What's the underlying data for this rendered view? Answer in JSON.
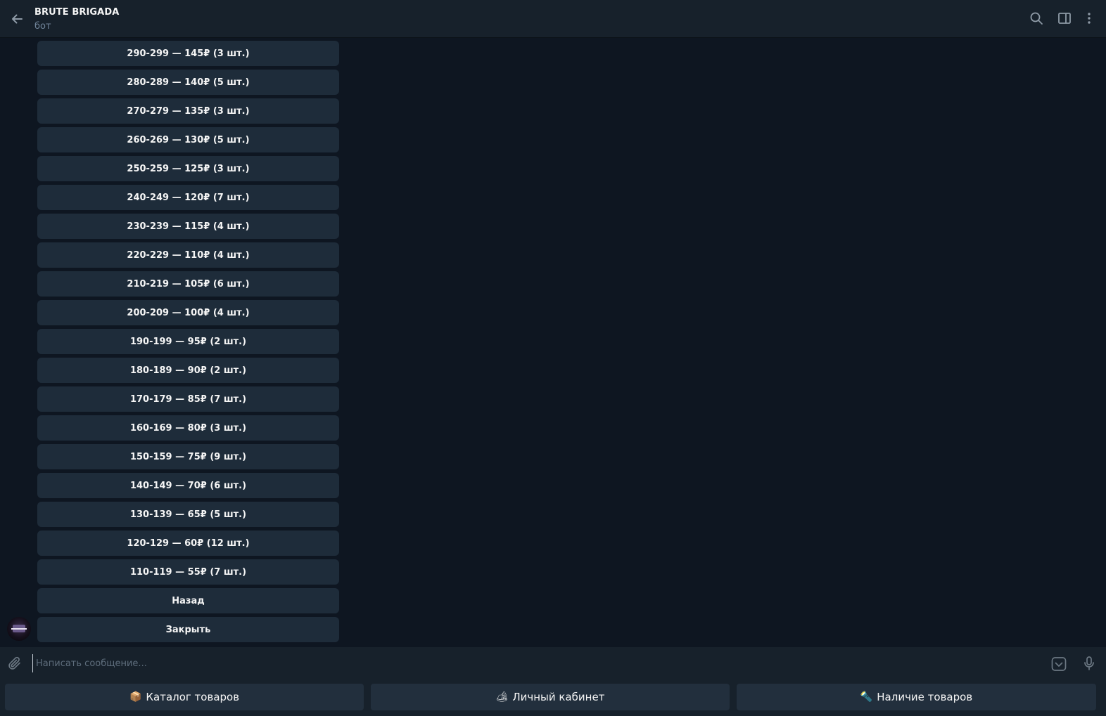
{
  "header": {
    "title": "BRUTE BRIGADA",
    "subtitle": "бот"
  },
  "inline_keyboard": [
    "290-299 — 145₽ (3 шт.)",
    "280-289 — 140₽ (5 шт.)",
    "270-279 — 135₽ (3 шт.)",
    "260-269 — 130₽ (5 шт.)",
    "250-259 — 125₽ (3 шт.)",
    "240-249 — 120₽ (7 шт.)",
    "230-239 — 115₽ (4 шт.)",
    "220-229 — 110₽ (4 шт.)",
    "210-219 — 105₽ (6 шт.)",
    "200-209 — 100₽ (4 шт.)",
    "190-199 — 95₽ (2 шт.)",
    "180-189 — 90₽ (2 шт.)",
    "170-179 — 85₽ (7 шт.)",
    "160-169 — 80₽ (3 шт.)",
    "150-159 — 75₽ (9 шт.)",
    "140-149 — 70₽ (6 шт.)",
    "130-139 — 65₽ (5 шт.)",
    "120-129 — 60₽ (12 шт.)",
    "110-119 — 55₽ (7 шт.)",
    "Назад",
    "Закрыть"
  ],
  "composer": {
    "placeholder": "Написать сообщение..."
  },
  "reply_keyboard": [
    {
      "emoji": "📦",
      "label": "Каталог товаров"
    },
    {
      "emoji": "🏕",
      "label": "Личный кабинет"
    },
    {
      "emoji": "🔦",
      "label": "Наличие товаров"
    }
  ],
  "icons": {
    "header_left": "back-arrow-icon",
    "header_right": [
      "search-icon",
      "sidebar-toggle-icon",
      "more-vertical-icon"
    ],
    "composer_left": "paperclip-icon",
    "composer_right": [
      "bot-keyboard-icon",
      "microphone-icon"
    ]
  },
  "colors": {
    "chat_background": "#0e1621",
    "header_background": "#17212b",
    "button_background": "#1e2c3a",
    "muted_text": "#708499"
  }
}
